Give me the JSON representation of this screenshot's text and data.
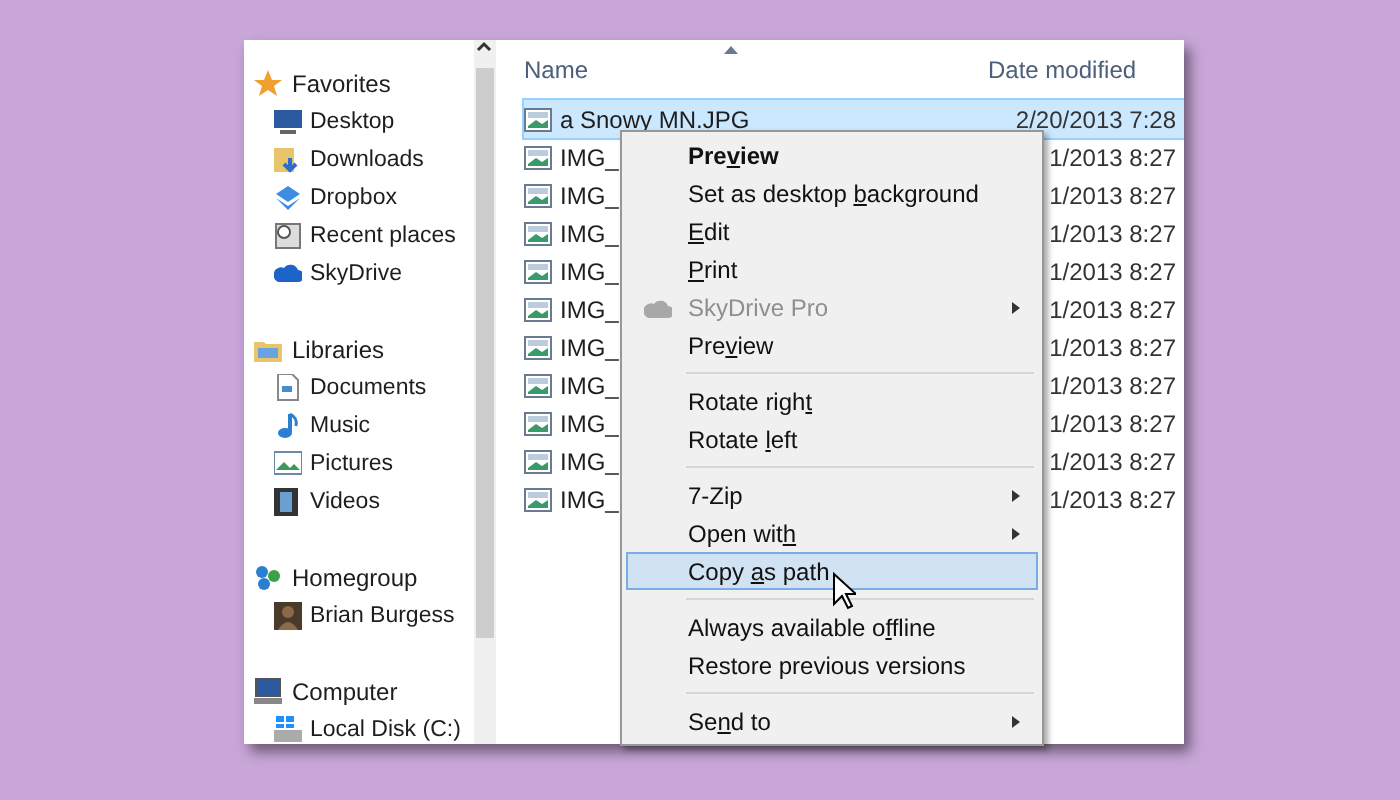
{
  "sidebar": {
    "groups": [
      {
        "label": "Favorites",
        "items": [
          {
            "label": "Desktop"
          },
          {
            "label": "Downloads"
          },
          {
            "label": "Dropbox"
          },
          {
            "label": "Recent places"
          },
          {
            "label": "SkyDrive"
          }
        ]
      },
      {
        "label": "Libraries",
        "items": [
          {
            "label": "Documents"
          },
          {
            "label": "Music"
          },
          {
            "label": "Pictures"
          },
          {
            "label": "Videos"
          }
        ]
      },
      {
        "label": "Homegroup",
        "items": [
          {
            "label": "Brian Burgess"
          }
        ]
      },
      {
        "label": "Computer",
        "items": [
          {
            "label": "Local Disk (C:)"
          }
        ]
      }
    ]
  },
  "file_list": {
    "columns": [
      "Name",
      "Date modified"
    ],
    "rows": [
      {
        "name": "a Snowy MN.JPG",
        "date": "2/20/2013 7:28",
        "selected": true
      },
      {
        "name": "IMG_",
        "date": "1/2013 8:27",
        "selected": false
      },
      {
        "name": "IMG_",
        "date": "1/2013 8:27",
        "selected": false
      },
      {
        "name": "IMG_",
        "date": "1/2013 8:27",
        "selected": false
      },
      {
        "name": "IMG_",
        "date": "1/2013 8:27",
        "selected": false
      },
      {
        "name": "IMG_",
        "date": "1/2013 8:27",
        "selected": false
      },
      {
        "name": "IMG_",
        "date": "1/2013 8:27",
        "selected": false
      },
      {
        "name": "IMG_",
        "date": "1/2013 8:27",
        "selected": false
      },
      {
        "name": "IMG_",
        "date": "1/2013 8:27",
        "selected": false
      },
      {
        "name": "IMG_",
        "date": "1/2013 8:27",
        "selected": false
      },
      {
        "name": "IMG_",
        "date": "1/2013 8:27",
        "selected": false
      }
    ]
  },
  "context_menu": [
    {
      "kind": "item",
      "label": [
        {
          "text": "Pre",
          "underlined": false
        },
        {
          "text": "v",
          "underlined": true
        },
        {
          "text": "iew",
          "underlined": false
        }
      ],
      "bold": true,
      "disabled": false,
      "submenu": false,
      "selected": false
    },
    {
      "kind": "item",
      "label": [
        {
          "text": "Set as desktop ",
          "underlined": false
        },
        {
          "text": "b",
          "underlined": true
        },
        {
          "text": "ackground",
          "underlined": false
        }
      ],
      "bold": false,
      "disabled": false,
      "submenu": false,
      "selected": false
    },
    {
      "kind": "item",
      "label": [
        {
          "text": "E",
          "underlined": true
        },
        {
          "text": "dit",
          "underlined": false
        }
      ],
      "bold": false,
      "disabled": false,
      "submenu": false,
      "selected": false
    },
    {
      "kind": "item",
      "label": [
        {
          "text": "P",
          "underlined": true
        },
        {
          "text": "rint",
          "underlined": false
        }
      ],
      "bold": false,
      "disabled": false,
      "submenu": false,
      "selected": false
    },
    {
      "kind": "item",
      "label": [
        {
          "text": "SkyDrive Pro",
          "underlined": false
        }
      ],
      "bold": false,
      "disabled": true,
      "submenu": true,
      "selected": false
    },
    {
      "kind": "item",
      "label": [
        {
          "text": "Pre",
          "underlined": false
        },
        {
          "text": "v",
          "underlined": true
        },
        {
          "text": "iew",
          "underlined": false
        }
      ],
      "bold": false,
      "disabled": false,
      "submenu": false,
      "selected": false
    },
    {
      "kind": "separator"
    },
    {
      "kind": "item",
      "label": [
        {
          "text": "Rotate righ",
          "underlined": false
        },
        {
          "text": "t",
          "underlined": true
        }
      ],
      "bold": false,
      "disabled": false,
      "submenu": false,
      "selected": false
    },
    {
      "kind": "item",
      "label": [
        {
          "text": "Rotate ",
          "underlined": false
        },
        {
          "text": "l",
          "underlined": true
        },
        {
          "text": "eft",
          "underlined": false
        }
      ],
      "bold": false,
      "disabled": false,
      "submenu": false,
      "selected": false
    },
    {
      "kind": "separator"
    },
    {
      "kind": "item",
      "label": [
        {
          "text": "7-Zip",
          "underlined": false
        }
      ],
      "bold": false,
      "disabled": false,
      "submenu": true,
      "selected": false
    },
    {
      "kind": "item",
      "label": [
        {
          "text": "Open wit",
          "underlined": false
        },
        {
          "text": "h",
          "underlined": true
        }
      ],
      "bold": false,
      "disabled": false,
      "submenu": true,
      "selected": false
    },
    {
      "kind": "item",
      "label": [
        {
          "text": "Copy ",
          "underlined": false
        },
        {
          "text": "a",
          "underlined": true
        },
        {
          "text": "s path",
          "underlined": false
        }
      ],
      "bold": false,
      "disabled": false,
      "submenu": false,
      "selected": true
    },
    {
      "kind": "separator"
    },
    {
      "kind": "item",
      "label": [
        {
          "text": "Always available o",
          "underlined": false
        },
        {
          "text": "f",
          "underlined": true
        },
        {
          "text": "fline",
          "underlined": false
        }
      ],
      "bold": false,
      "disabled": false,
      "submenu": false,
      "selected": false
    },
    {
      "kind": "item",
      "label": [
        {
          "text": "Restore previous versions",
          "underlined": false
        }
      ],
      "bold": false,
      "disabled": false,
      "submenu": false,
      "selected": false
    },
    {
      "kind": "separator"
    },
    {
      "kind": "item",
      "label": [
        {
          "text": "Se",
          "underlined": false
        },
        {
          "text": "n",
          "underlined": true
        },
        {
          "text": "d to",
          "underlined": false
        }
      ],
      "bold": false,
      "disabled": false,
      "submenu": true,
      "selected": false
    }
  ]
}
